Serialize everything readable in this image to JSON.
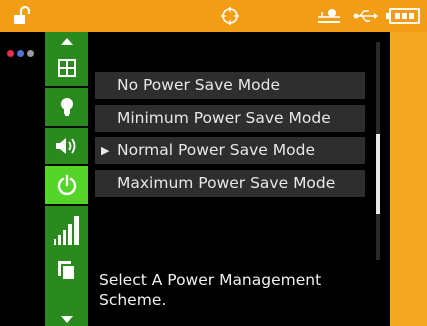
{
  "statusbar": {
    "icons": [
      "lock-open-icon",
      "crosshair-target-icon",
      "usb-device-icon",
      "usb-icon",
      "battery-icon"
    ]
  },
  "leftpanel": {
    "dot_colors": [
      "#e0304a",
      "#4f74d8",
      "#9a9a9a"
    ]
  },
  "sidebar": {
    "items": [
      {
        "icon": "scroll-up-arrow-icon"
      },
      {
        "icon": "grid-icon"
      },
      {
        "icon": "lightbulb-icon"
      },
      {
        "icon": "volume-icon"
      },
      {
        "icon": "power-icon",
        "active": true
      },
      {
        "icon": "signal-strength-icon"
      },
      {
        "icon": "copy-pages-icon"
      },
      {
        "icon": "scroll-down-arrow-icon"
      }
    ]
  },
  "power_modes": {
    "options": [
      {
        "label": "No Power Save Mode",
        "selected": false
      },
      {
        "label": "Minimum Power Save Mode",
        "selected": false
      },
      {
        "label": "Normal Power Save Mode",
        "selected": true
      },
      {
        "label": "Maximum Power Save Mode",
        "selected": false
      }
    ],
    "selected_marker": "▶",
    "hint": "Select A Power Management Scheme."
  },
  "colors": {
    "frame": "#f5a623",
    "sidebar": "#2b8a1e",
    "sidebar_active": "#55d42a",
    "option_bg": "#2e2e2e",
    "text": "#e8e8e8"
  }
}
